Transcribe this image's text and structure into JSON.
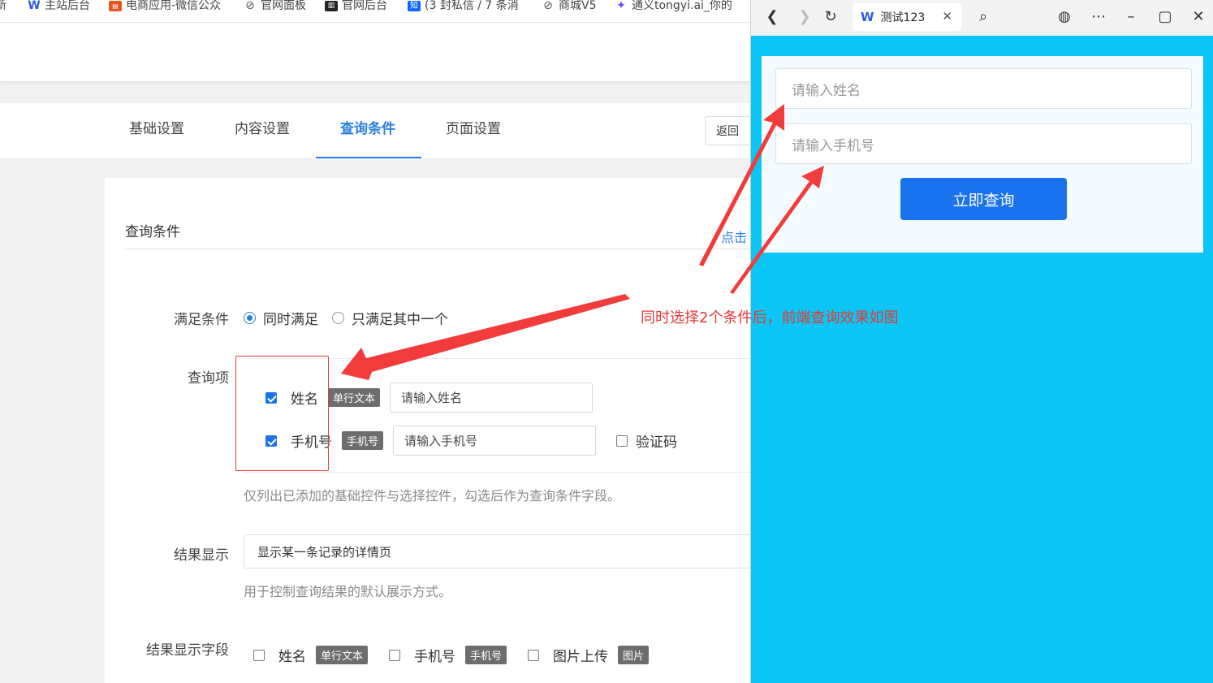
{
  "bookmarks": [
    {
      "label": "新",
      "icon": "none",
      "color": "#000000"
    },
    {
      "label": "主站后台",
      "icon": "w-logo-icon",
      "color": "#2d5be3"
    },
    {
      "label": "电商应用-微信公众",
      "icon": "shop-icon",
      "color": "#e8561e"
    },
    {
      "label": "官网面板",
      "icon": "link-icon",
      "color": "#555555"
    },
    {
      "label": "官网后台",
      "icon": "dark-logo-icon",
      "color": "#222222"
    },
    {
      "label": "(3 封私信 / 7 条消",
      "icon": "zhihu-icon",
      "color": "#0a66ff"
    },
    {
      "label": "商城V5",
      "icon": "link-icon",
      "color": "#555555"
    },
    {
      "label": "通义tongyi.ai_你的",
      "icon": "tongyi-icon",
      "color": "#6a4cff"
    }
  ],
  "tabs": [
    "基础设置",
    "内容设置",
    "查询条件",
    "页面设置"
  ],
  "active_tab": "查询条件",
  "back_label": "返回",
  "section": {
    "title": "查询条件",
    "link": "点击"
  },
  "form": {
    "condition_label": "满足条件",
    "condition_options": [
      "同时满足",
      "只满足其中一个"
    ],
    "condition_selected": "同时满足",
    "query_label": "查询项",
    "query_items": [
      {
        "name": "姓名",
        "tag": "单行文本",
        "placeholder": "请输入姓名",
        "checked": true
      },
      {
        "name": "手机号",
        "tag": "手机号",
        "placeholder": "请输入手机号",
        "checked": true
      }
    ],
    "captcha_label": "验证码",
    "query_hint": "仅列出已添加的基础控件与选择控件，勾选后作为查询条件字段。",
    "result_label": "结果显示",
    "result_value": "显示某一条记录的详情页",
    "result_hint": "用于控制查询结果的默认展示方式。",
    "result_fields_label": "结果显示字段",
    "result_fields": [
      {
        "name": "姓名",
        "tag": "单行文本"
      },
      {
        "name": "手机号",
        "tag": "手机号"
      },
      {
        "name": "图片上传",
        "tag": "图片"
      }
    ]
  },
  "annotation": "同时选择2个条件后，前端查询效果如图",
  "preview": {
    "tab_title": "测试123",
    "fields": [
      "请输入姓名",
      "请输入手机号"
    ],
    "submit": "立即查询",
    "background_color": "#0bc6f4",
    "button_color": "#1a73ee"
  }
}
